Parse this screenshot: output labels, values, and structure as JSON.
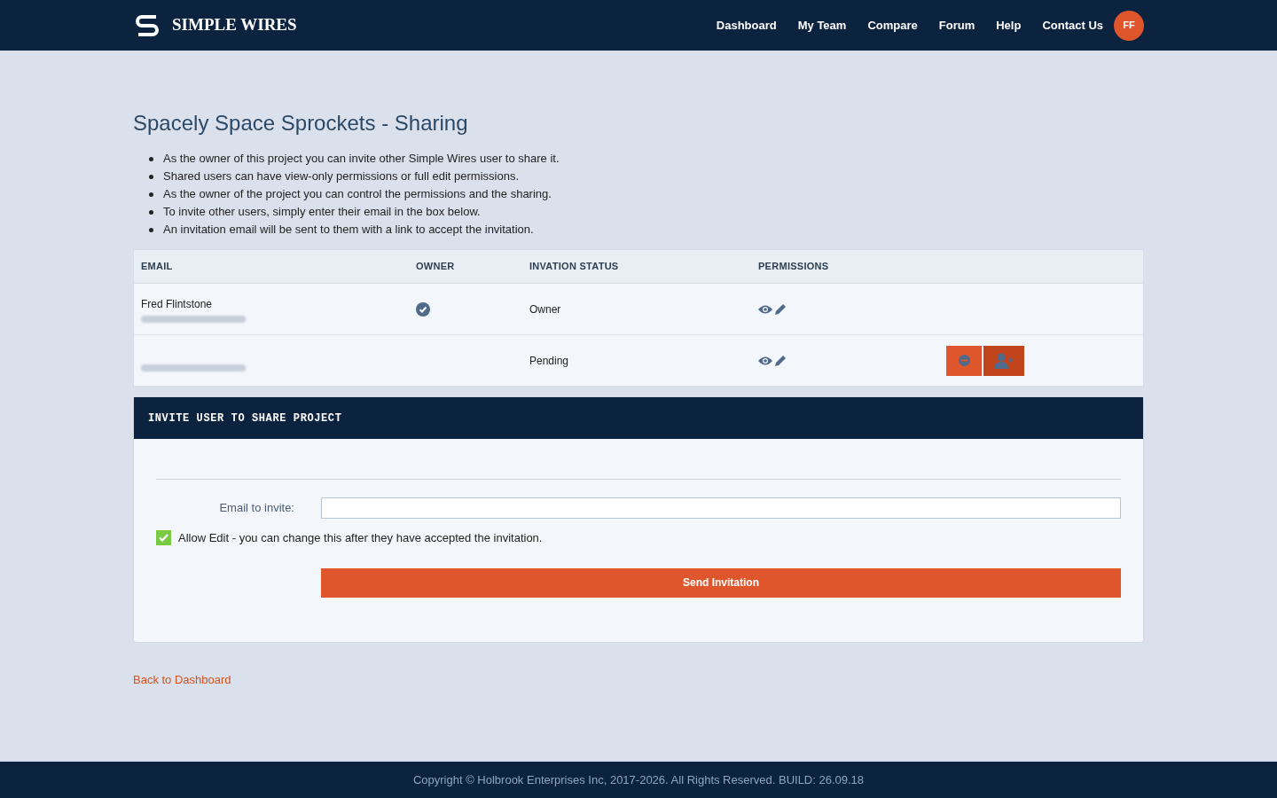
{
  "brand": {
    "name": "SIMPLE WIRES"
  },
  "nav": [
    "Dashboard",
    "My Team",
    "Compare",
    "Forum",
    "Help",
    "Contact Us"
  ],
  "avatar": {
    "initials": "FF"
  },
  "title": "Spacely Space Sprockets - Sharing",
  "notes": [
    "As the owner of this project you can invite other Simple Wires user to share it.",
    "Shared users can have view-only permissions or full edit permissions.",
    "As the owner of the project you can control the permissions and the sharing.",
    "To invite other users, simply enter their email in the box below.",
    "An invitation email will be sent to them with a link to accept the invitation."
  ],
  "table": {
    "columns": [
      "EMAIL",
      "OWNER",
      "INVATION STATUS",
      "PERMISSIONS"
    ],
    "rows": [
      {
        "name": "Fred Flintstone",
        "owner": true,
        "status": "Owner",
        "can_view": true,
        "can_edit": true,
        "removable": false
      },
      {
        "owner": false,
        "status": "Pending",
        "can_view": true,
        "can_edit": true,
        "removable": true
      }
    ]
  },
  "invite": {
    "heading": "INVITE USER TO SHARE PROJECT",
    "email_label": "Email to invite:",
    "allow_edit": {
      "label": "Allow Edit - you can change this after they have accepted the invitation.",
      "checked": true
    },
    "submit": "Send Invitation"
  },
  "back_link": "Back to Dashboard",
  "footer": "Copyright © Holbrook Enterprises Inc, 2017-2026. All Rights Reserved. BUILD: 26.09.18"
}
